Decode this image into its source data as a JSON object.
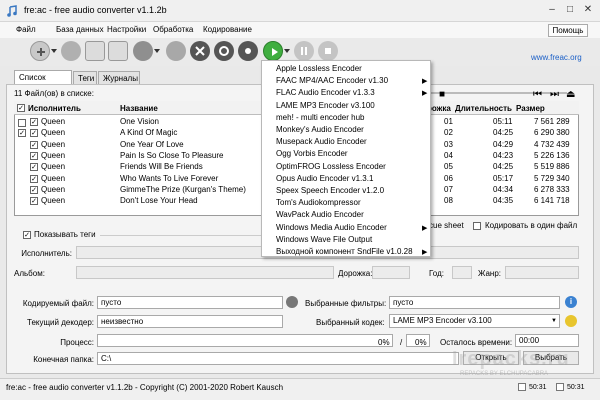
{
  "window": {
    "title": "fre:ac - free audio converter v1.1.2b"
  },
  "menu": {
    "items": [
      "Файл",
      "База данных",
      "Настройки",
      "Обработка",
      "Кодирование"
    ],
    "help": "Помощь"
  },
  "toolbar": {
    "website": "www.freac.org"
  },
  "tabs": [
    "Список задач",
    "Теги",
    "Журналы"
  ],
  "list": {
    "count_label": "11 Файл(ов) в списке:",
    "headers": {
      "artist": "Исполнитель",
      "title": "Название",
      "track": "рожка",
      "duration": "Длительность",
      "size": "Размер"
    },
    "rows": [
      {
        "artist": "Queen",
        "title": "One Vision",
        "track": "01",
        "duration": "05:11",
        "size": "7 561 289"
      },
      {
        "artist": "Queen",
        "title": "A Kind Of Magic",
        "track": "02",
        "duration": "04:25",
        "size": "6 290 380"
      },
      {
        "artist": "Queen",
        "title": "One Year Of Love",
        "track": "03",
        "duration": "04:29",
        "size": "4 732 439"
      },
      {
        "artist": "Queen",
        "title": "Pain Is So Close To Pleasure",
        "track": "04",
        "duration": "04:23",
        "size": "5 226 136"
      },
      {
        "artist": "Queen",
        "title": "Friends Will Be Friends",
        "track": "05",
        "duration": "04:25",
        "size": "5 519 886"
      },
      {
        "artist": "Queen",
        "title": "Who Wants To Live Forever",
        "track": "06",
        "duration": "05:17",
        "size": "5 729 340"
      },
      {
        "artist": "Queen",
        "title": "GimmeThe Prize (Kurgan's Theme)",
        "track": "07",
        "duration": "04:34",
        "size": "6 278 333"
      },
      {
        "artist": "Queen",
        "title": "Don't Lose Your Head",
        "track": "08",
        "duration": "04:35",
        "size": "6 141 718"
      }
    ]
  },
  "cue_sheet": "cue sheet",
  "encode_single": "Кодировать в один файл",
  "tags": {
    "show_label": "Показывать теги",
    "artist_label": "Исполнитель:",
    "album_label": "Альбом:",
    "track_label": "Дорожка:",
    "year_label": "Год:",
    "genre_label": "Жанр:"
  },
  "encoder_menu": {
    "items": [
      {
        "label": "Apple Lossless Encoder",
        "sub": false
      },
      {
        "label": "FAAC MP4/AAC Encoder v1.30",
        "sub": true
      },
      {
        "label": "FLAC Audio Encoder v1.3.3",
        "sub": true
      },
      {
        "label": "LAME MP3 Encoder v3.100",
        "sub": false
      },
      {
        "label": "meh! - multi encoder hub",
        "sub": false
      },
      {
        "label": "Monkey's Audio Encoder",
        "sub": false
      },
      {
        "label": "Musepack Audio Encoder",
        "sub": false
      },
      {
        "label": "Ogg Vorbis Encoder",
        "sub": false
      },
      {
        "label": "OptimFROG Lossless Encoder",
        "sub": false
      },
      {
        "label": "Opus Audio Encoder v1.3.1",
        "sub": false
      },
      {
        "label": "Speex Speech Encoder v1.2.0",
        "sub": false
      },
      {
        "label": "Tom's Audiokompressor",
        "sub": false
      },
      {
        "label": "WavPack Audio Encoder",
        "sub": false
      },
      {
        "label": "Windows Media Audio Encoder",
        "sub": true
      },
      {
        "label": "Windows Wave File Output",
        "sub": false
      },
      {
        "label": "Выходной компонент SndFile v1.0.28",
        "sub": true
      }
    ]
  },
  "status": {
    "encoding_file_label": "Кодируемый файл:",
    "encoding_file_value": "пусто",
    "filters_label": "Выбранные фильтры:",
    "filters_value": "пусто",
    "decoder_label": "Текущий декодер:",
    "decoder_value": "неизвестно",
    "codec_label": "Выбранный кодек:",
    "codec_value": "LAME MP3 Encoder v3.100",
    "progress_label": "Процесс:",
    "progress1": "0%",
    "progress_sep": "/",
    "progress2": "0%",
    "remaining_label": "Осталось времени:",
    "remaining_value": "00:00",
    "folder_label": "Конечная папка:",
    "folder_value": "C:\\",
    "open_button": "Открыть",
    "choose_button": "Выбрать"
  },
  "statusbar": {
    "text": "fre:ac - free audio converter v1.1.2b - Copyright (C) 2001-2020 Robert Kausch",
    "time1": "50:31",
    "time2": "50:31"
  },
  "watermark": {
    "main": "Irepacks.ru",
    "sub": "REPACKS BY ELCHUPACABRA"
  }
}
